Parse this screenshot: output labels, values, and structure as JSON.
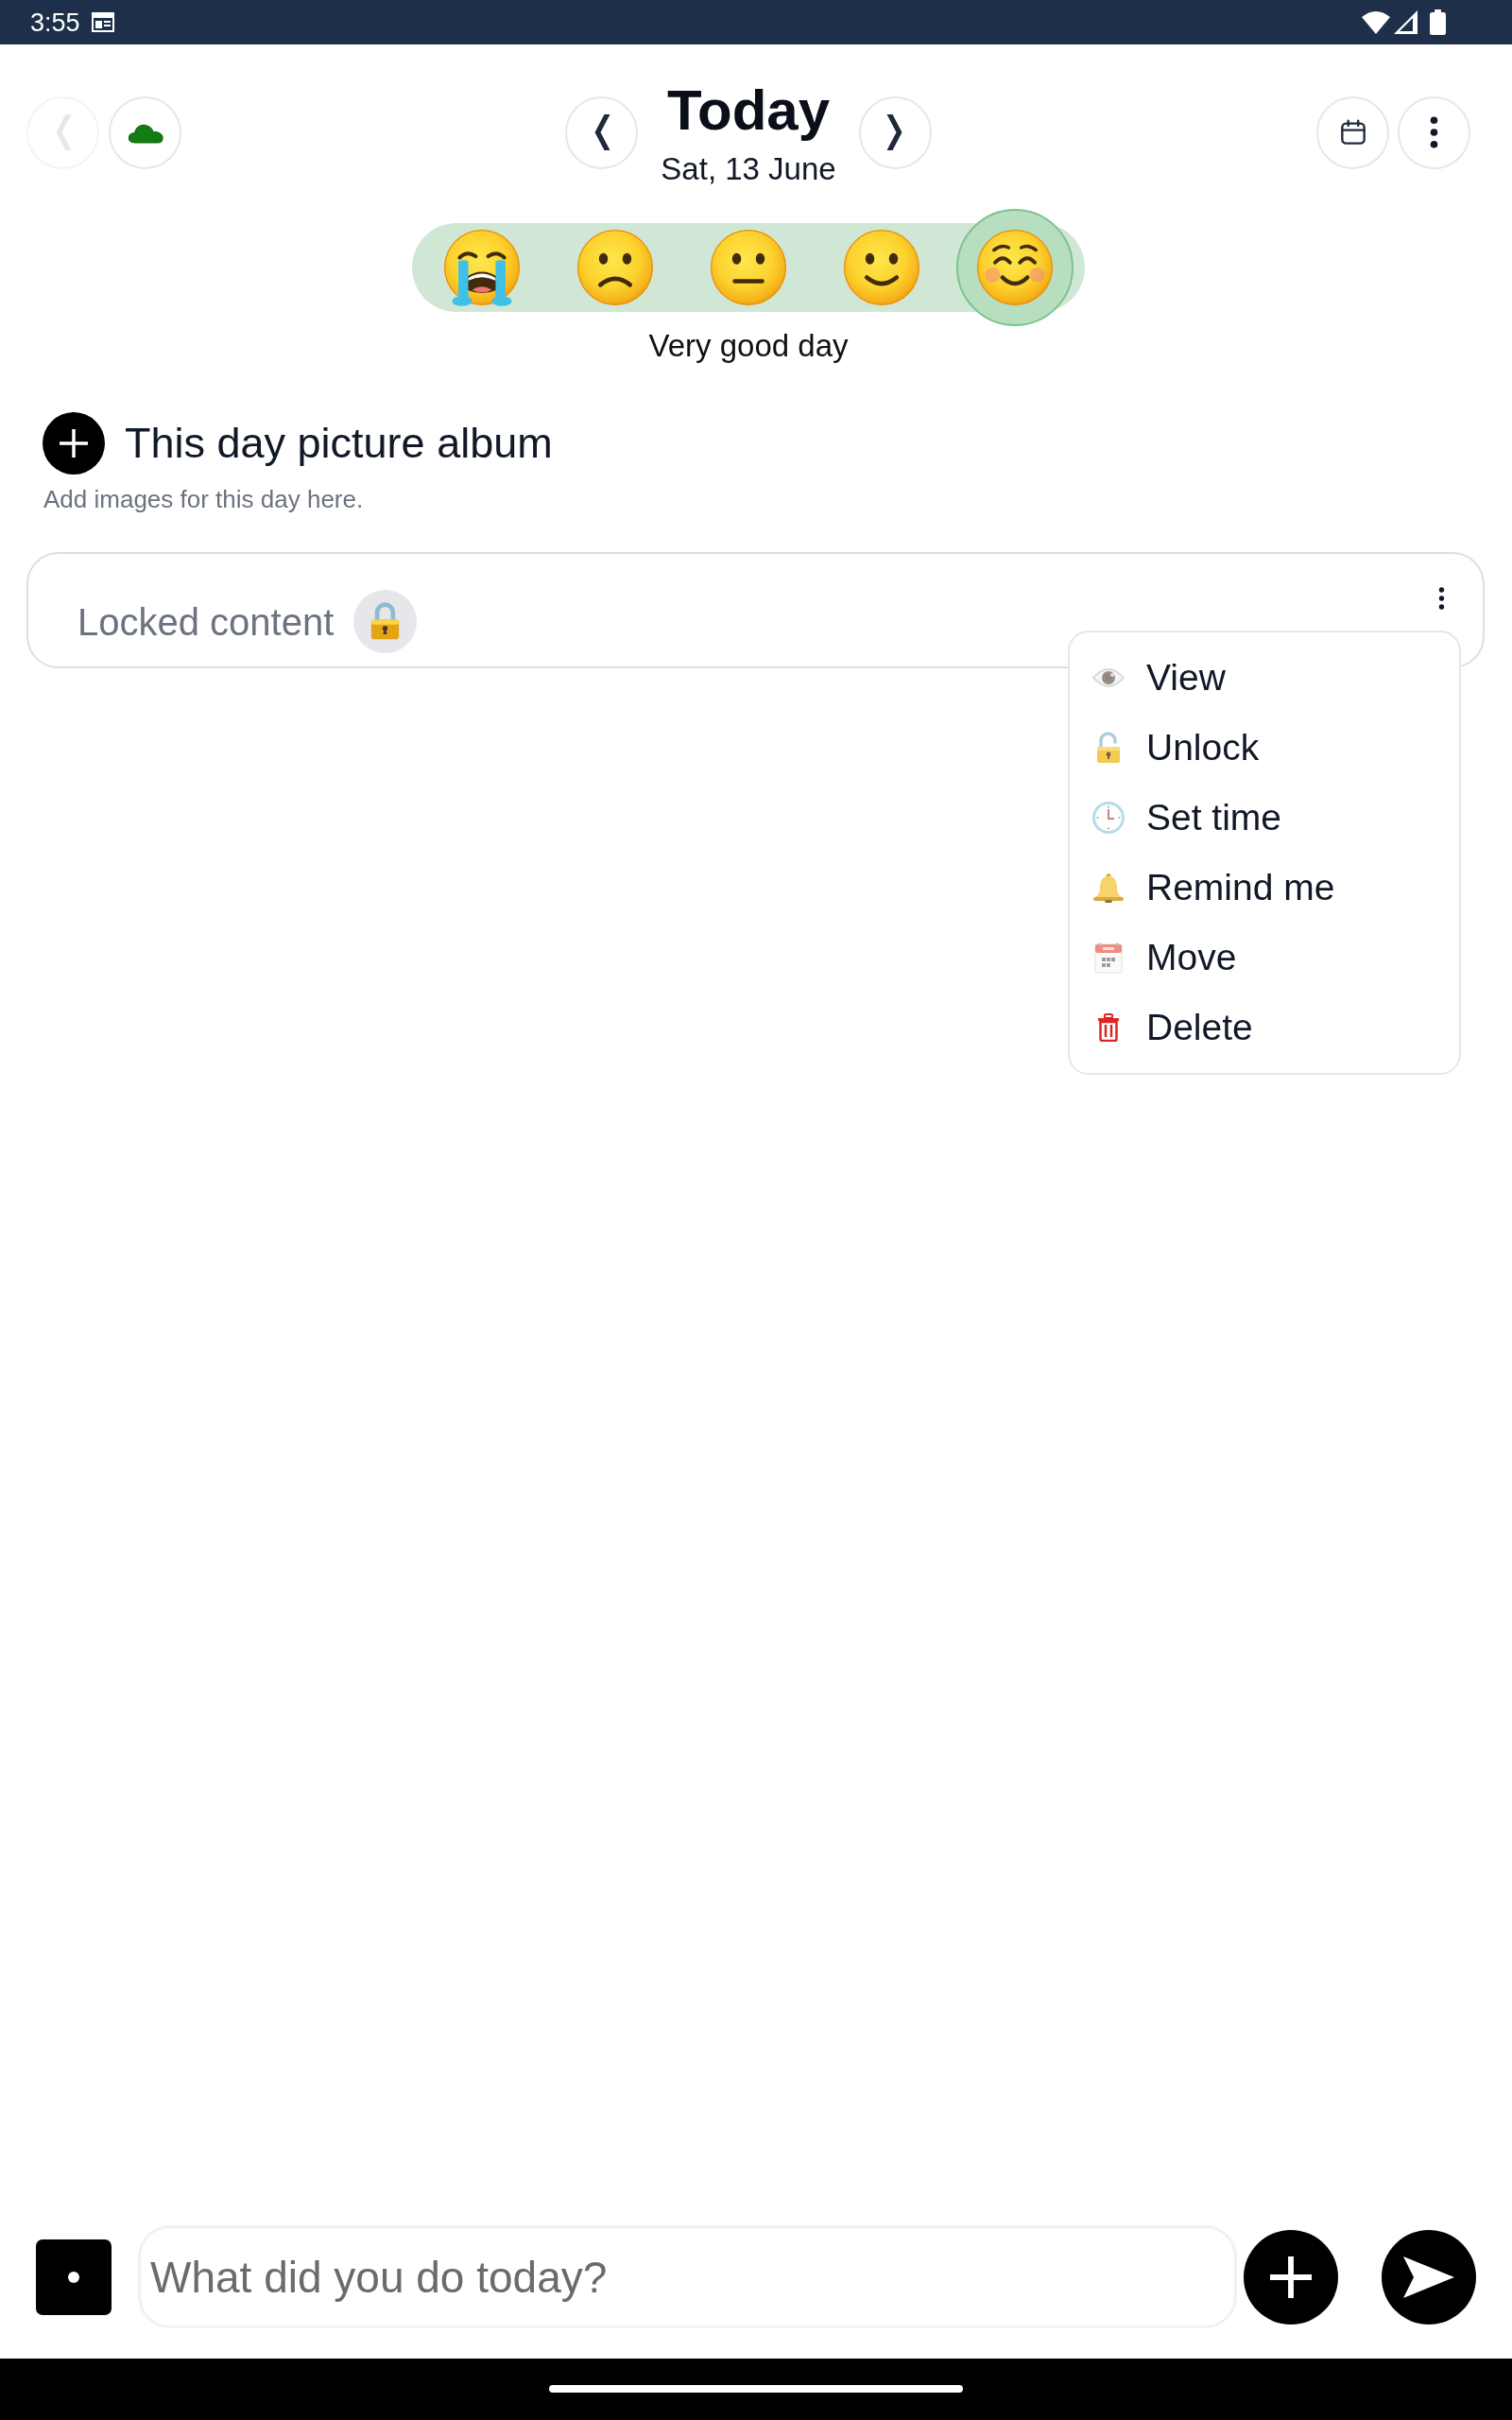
{
  "status_bar": {
    "time": "3:55"
  },
  "header": {
    "back": {
      "disabled": true
    },
    "title": "Today",
    "date": "Sat, 13 June"
  },
  "mood": {
    "options": [
      {
        "kind": "crying",
        "selected": false
      },
      {
        "kind": "frowning",
        "selected": false
      },
      {
        "kind": "neutral",
        "selected": false
      },
      {
        "kind": "smiling",
        "selected": false
      },
      {
        "kind": "blushing",
        "selected": true
      }
    ],
    "label": "Very good day"
  },
  "album": {
    "title": "This day picture album",
    "hint": "Add images for this day here."
  },
  "entry": {
    "label": "Locked content",
    "menu": [
      {
        "kind": "view",
        "label": "View"
      },
      {
        "kind": "unlock",
        "label": "Unlock"
      },
      {
        "kind": "time",
        "label": "Set time"
      },
      {
        "kind": "remind",
        "label": "Remind me"
      },
      {
        "kind": "move",
        "label": "Move"
      },
      {
        "kind": "delete",
        "label": "Delete"
      }
    ]
  },
  "composer": {
    "placeholder": "What did you do today?"
  }
}
